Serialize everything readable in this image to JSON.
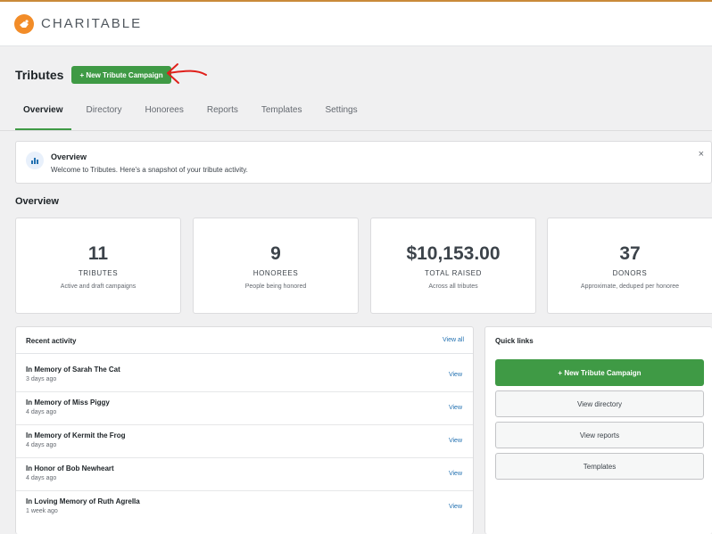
{
  "brand": {
    "name": "CHARITABLE"
  },
  "header": {
    "title": "Tributes",
    "new_button": "+ New Tribute Campaign"
  },
  "tabs": [
    {
      "label": "Overview",
      "active": true
    },
    {
      "label": "Directory"
    },
    {
      "label": "Honorees"
    },
    {
      "label": "Reports"
    },
    {
      "label": "Templates"
    },
    {
      "label": "Settings"
    }
  ],
  "notice": {
    "title": "Overview",
    "text": "Welcome to Tributes. Here's a snapshot of your tribute activity.",
    "close": "×"
  },
  "overview": {
    "title": "Overview",
    "stats": [
      {
        "value": "11",
        "label": "TRIBUTES",
        "sub": "Active and draft campaigns"
      },
      {
        "value": "9",
        "label": "HONOREES",
        "sub": "People being honored"
      },
      {
        "value": "$10,153.00",
        "label": "TOTAL RAISED",
        "sub": "Across all tributes"
      },
      {
        "value": "37",
        "label": "DONORS",
        "sub": "Approximate, deduped per honoree"
      }
    ]
  },
  "activity": {
    "title": "Recent activity",
    "view_all": "View all",
    "items": [
      {
        "name": "In Memory of Sarah The Cat",
        "time": "3 days ago",
        "action": "View"
      },
      {
        "name": "In Memory of Miss Piggy",
        "time": "4 days ago",
        "action": "View"
      },
      {
        "name": "In Memory of Kermit the Frog",
        "time": "4 days ago",
        "action": "View"
      },
      {
        "name": "In Honor of Bob Newheart",
        "time": "4 days ago",
        "action": "View"
      },
      {
        "name": "In Loving Memory of Ruth Agrella",
        "time": "1 week ago",
        "action": "View"
      }
    ]
  },
  "quick_links": {
    "title": "Quick links",
    "primary": "+ New Tribute Campaign",
    "links": [
      "View directory",
      "View reports",
      "Templates"
    ]
  },
  "colors": {
    "accent": "#3f9a45",
    "logo": "#f28c28",
    "link": "#2271b1",
    "annotation": "#e0201b"
  }
}
